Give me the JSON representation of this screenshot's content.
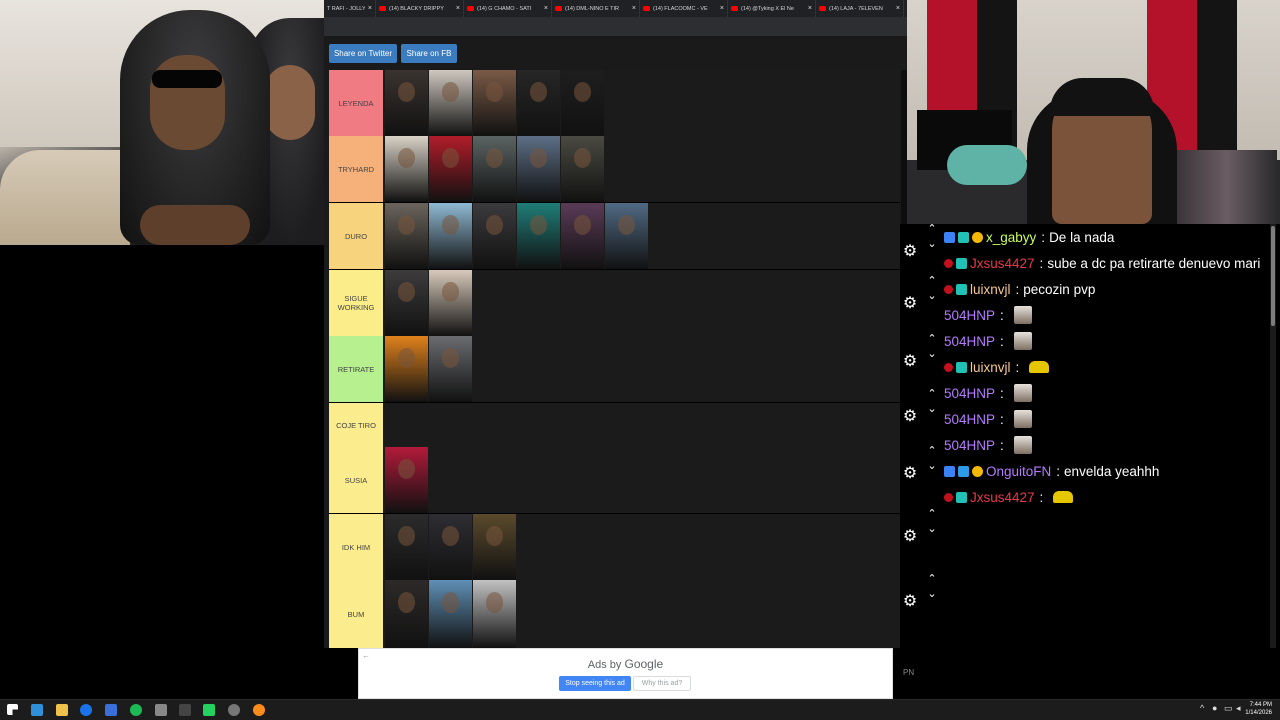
{
  "browser": {
    "tabs": [
      {
        "label": "T RAFI - JOLLY",
        "favicon": "youtube-icon"
      },
      {
        "label": "(14) BLACKY DRIPPY",
        "favicon": "youtube-icon"
      },
      {
        "label": "(14) G CHAMO - SATI",
        "favicon": "youtube-icon"
      },
      {
        "label": "(14) DML-NIÑO E TIR",
        "favicon": "youtube-icon"
      },
      {
        "label": "(14) FLACOOMC - VE",
        "favicon": "youtube-icon"
      },
      {
        "label": "(14) @Tyking X El Ne",
        "favicon": "youtube-icon"
      },
      {
        "label": "(14) LAJA - 7ELEVEN",
        "favicon": "youtube-icon"
      }
    ]
  },
  "tierlist": {
    "share_twitter": "Share on Twitter",
    "share_fb": "Share on FB",
    "tiers": [
      {
        "label": "LEYENDA",
        "color": "#f07b83",
        "items": [
          "#3a3330",
          "#cfc8c0",
          "#7a5a46",
          "#262626",
          "#1e1e1e"
        ]
      },
      {
        "label": "TRYHARD",
        "color": "#f6b07a",
        "items": [
          "#d9d2c6",
          "#b21c2a",
          "#5b6463",
          "#5d6f86",
          "#4a4a42"
        ]
      },
      {
        "label": "DURO",
        "color": "#f8d37d",
        "items": [
          "#6a645c",
          "#8fb9d3",
          "#3b3a3d",
          "#1f7d78",
          "#5a3b57",
          "#506a84"
        ]
      },
      {
        "label": "SIGUE\nWORKING",
        "color": "#fbee8a",
        "items": [
          "#3d3b3c",
          "#d8cabb"
        ]
      },
      {
        "label": "RETIRATE",
        "color": "#b7f08f",
        "items": [
          "#e0821c",
          "#6b6c70"
        ]
      },
      {
        "label": "COJE  TIRO",
        "color": "#fbec8d",
        "items": []
      },
      {
        "label": "SUSIA",
        "color": "#fbec8d",
        "items": [
          "#b21a3a"
        ]
      },
      {
        "label": "IDK HIM",
        "color": "#fbec8d",
        "items": [
          "#2b2b2b",
          "#2e2e33",
          "#5a4a2c"
        ]
      },
      {
        "label": "BUM",
        "color": "#fbec8d",
        "items": [
          "#2d2a29",
          "#5f8fb5",
          "#c2c2c2"
        ]
      }
    ]
  },
  "chat": {
    "messages": [
      {
        "user": "x_gabyy",
        "color": "#c8ff5a",
        "badges": [
          "prime",
          "sub",
          "gold"
        ],
        "text": "De la nada",
        "emote": ""
      },
      {
        "user": "Jxsus4427",
        "color": "#e7394a",
        "badges": [
          "red",
          "sub"
        ],
        "text": "sube a dc pa retirarte denuevo mari",
        "emote": ""
      },
      {
        "user": "luixnvjl",
        "color": "#f7c78c",
        "badges": [
          "red",
          "sub"
        ],
        "text": "pecozin pvp",
        "emote": ""
      },
      {
        "user": "504HNP",
        "color": "#b57bff",
        "badges": [],
        "text": "",
        "emote": "face"
      },
      {
        "user": "504HNP",
        "color": "#b57bff",
        "badges": [],
        "text": "",
        "emote": "face"
      },
      {
        "user": "luixnvjl",
        "color": "#f7c78c",
        "badges": [
          "red",
          "sub"
        ],
        "text": "",
        "emote": "car"
      },
      {
        "user": "504HNP",
        "color": "#b57bff",
        "badges": [],
        "text": "",
        "emote": "face"
      },
      {
        "user": "504HNP",
        "color": "#b57bff",
        "badges": [],
        "text": "",
        "emote": "face"
      },
      {
        "user": "504HNP",
        "color": "#b57bff",
        "badges": [],
        "text": "",
        "emote": "face"
      },
      {
        "user": "OnguitoFN",
        "color": "#b57bff",
        "badges": [
          "prime",
          "blue",
          "gold"
        ],
        "text": "envelda yeahhh",
        "emote": ""
      },
      {
        "user": "Jxsus4427",
        "color": "#e7394a",
        "badges": [
          "red",
          "sub"
        ],
        "text": "",
        "emote": "car"
      }
    ],
    "separator": ":"
  },
  "ad": {
    "ads_by": "Ads by",
    "google": "Google",
    "stop": "Stop seeing this ad",
    "why": "Why this ad?"
  },
  "misc": {
    "pn": "PN"
  },
  "taskbar": {
    "time": "7:44 PM",
    "date": "1/14/2026"
  }
}
